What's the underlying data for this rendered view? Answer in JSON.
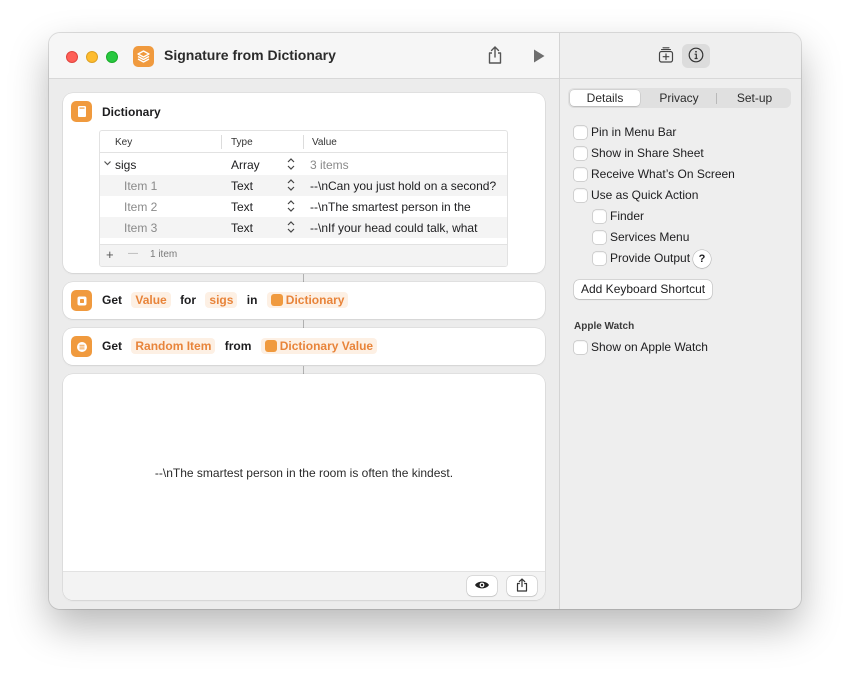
{
  "window": {
    "title": "Signature from Dictionary"
  },
  "dictionary_card": {
    "title": "Dictionary",
    "columns": {
      "key": "Key",
      "type": "Type",
      "value": "Value"
    },
    "rows": [
      {
        "key": "sigs",
        "type": "Array",
        "value": "3 items"
      },
      {
        "key": "Item 1",
        "type": "Text",
        "value": "--\\nCan you just hold on a second?"
      },
      {
        "key": "Item 2",
        "type": "Text",
        "value": "--\\nThe smartest person in the"
      },
      {
        "key": "Item 3",
        "type": "Text",
        "value": "--\\nIf your head could talk, what"
      }
    ],
    "footer": {
      "add": "+",
      "remove": "—",
      "count": "1 item"
    }
  },
  "get_value_card": {
    "w1": "Get",
    "p1": "Value",
    "w2": "for",
    "p2": "sigs",
    "w3": "in",
    "p3": "Dictionary"
  },
  "get_random_card": {
    "w1": "Get",
    "p1": "Random Item",
    "w2": "from",
    "p2": "Dictionary Value"
  },
  "result": {
    "text": "--\\nThe smartest person in the room is often the kindest."
  },
  "inspector": {
    "tabs": {
      "details": "Details",
      "privacy": "Privacy",
      "setup": "Set-up"
    },
    "options": {
      "pin_menu_bar": "Pin in Menu Bar",
      "share_sheet": "Show in Share Sheet",
      "on_screen": "Receive What’s On Screen",
      "quick_action": "Use as Quick Action",
      "finder": "Finder",
      "services_menu": "Services Menu",
      "provide_output": "Provide Output",
      "help": "?"
    },
    "shortcut_button": "Add Keyboard Shortcut",
    "apple_watch_header": "Apple Watch",
    "apple_watch_option": "Show on Apple Watch"
  },
  "colors": {
    "accent": "#f09a3e",
    "pill_text": "#e8843a",
    "pill_bg": "#fdf0e4"
  }
}
